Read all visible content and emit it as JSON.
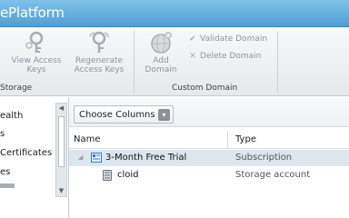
{
  "app": {
    "title": "Platform",
    "title_prefix_fragment": "e"
  },
  "ribbon": {
    "storage_group": {
      "label": "Storage",
      "view_access_keys": {
        "line1": "View Access",
        "line2": "Keys"
      },
      "regenerate_access_keys": {
        "line1": "Regenerate",
        "line2": "Access Keys"
      }
    },
    "custom_domain_group": {
      "label": "Custom Domain",
      "add_domain": {
        "line1": "Add",
        "line2": "Domain"
      },
      "validate_domain": "Validate Domain",
      "delete_domain": "Delete Domain"
    }
  },
  "leftnav": {
    "items": [
      {
        "label": "ealth"
      },
      {
        "label": "s"
      },
      {
        "label": "Certificates"
      },
      {
        "label": "es"
      }
    ],
    "progress_fraction": 0.2
  },
  "toolbar": {
    "choose_columns": "Choose Columns"
  },
  "grid": {
    "columns": [
      "Name",
      "Type"
    ],
    "rows": [
      {
        "name": "3-Month Free Trial",
        "type": "Subscription",
        "selected": true,
        "icon": "subscription-icon"
      },
      {
        "name": "cloid",
        "type": "Storage account",
        "selected": false,
        "icon": "storage-account-icon"
      }
    ]
  },
  "colors": {
    "titlebar": "#5aa8dc",
    "selected_row": "#dde6ef"
  }
}
